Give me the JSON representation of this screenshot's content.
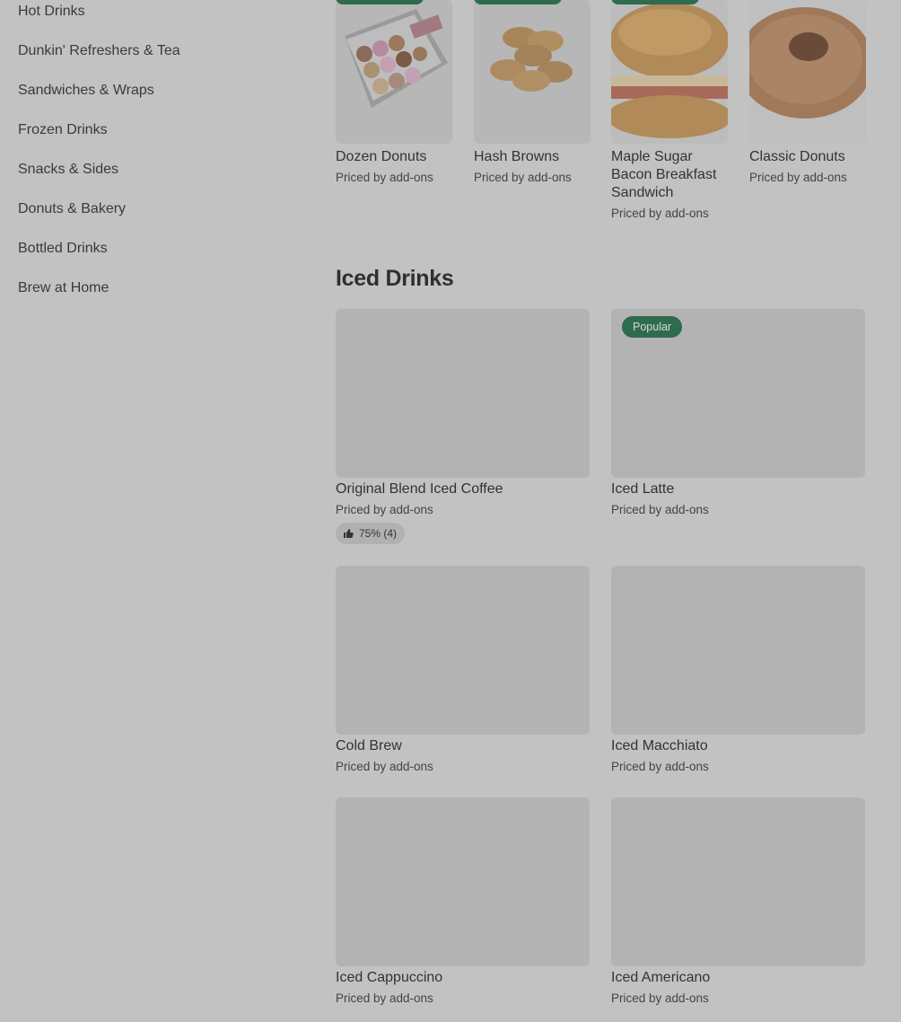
{
  "sidebar": {
    "items": [
      {
        "label": "Hot Drinks"
      },
      {
        "label": "Dunkin' Refreshers & Tea"
      },
      {
        "label": "Sandwiches & Wraps"
      },
      {
        "label": "Frozen Drinks"
      },
      {
        "label": "Snacks & Sides"
      },
      {
        "label": "Donuts & Bakery"
      },
      {
        "label": "Bottled Drinks"
      },
      {
        "label": "Brew at Home"
      }
    ]
  },
  "top_items": [
    {
      "name": "Dozen Donuts",
      "price": "Priced by add-ons",
      "icon": "donut-box-image"
    },
    {
      "name": "Hash Browns",
      "price": "Priced by add-ons",
      "icon": "hash-browns-image"
    },
    {
      "name": "Maple Sugar Bacon Breakfast Sandwich",
      "price": "Priced by add-ons",
      "icon": "croissant-sandwich-image"
    },
    {
      "name": "Classic Donuts",
      "price": "Priced by add-ons",
      "icon": "donut-image"
    }
  ],
  "iced_section": {
    "title": "Iced Drinks",
    "items": [
      {
        "name": "Original Blend Iced Coffee",
        "price": "Priced by add-ons",
        "rating": "75% (4)"
      },
      {
        "name": "Iced Latte",
        "price": "Priced by add-ons",
        "badge": "Popular"
      },
      {
        "name": "Cold Brew",
        "price": "Priced by add-ons"
      },
      {
        "name": "Iced Macchiato",
        "price": "Priced by add-ons"
      },
      {
        "name": "Iced Cappuccino",
        "price": "Priced by add-ons"
      },
      {
        "name": "Iced Americano",
        "price": "Priced by add-ons"
      }
    ]
  },
  "colors": {
    "overlay": "#c2c2c2",
    "badge": "#2f6b4d",
    "thumb": "#b3b3b3"
  }
}
